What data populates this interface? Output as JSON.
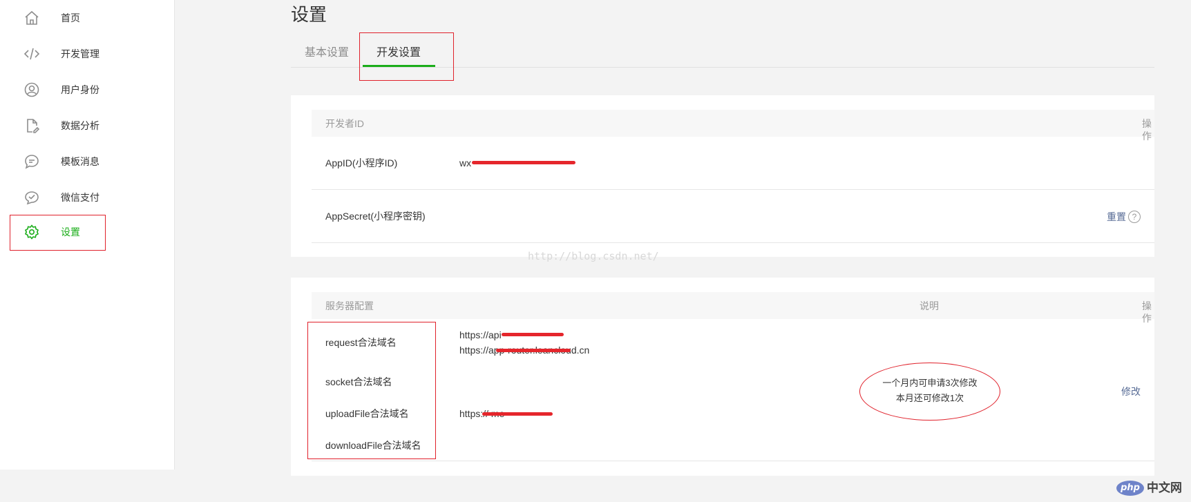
{
  "sidebar": {
    "items": [
      {
        "label": "首页",
        "icon": "home-icon"
      },
      {
        "label": "开发管理",
        "icon": "code-icon"
      },
      {
        "label": "用户身份",
        "icon": "user-icon"
      },
      {
        "label": "数据分析",
        "icon": "file-edit-icon"
      },
      {
        "label": "模板消息",
        "icon": "chat-icon"
      },
      {
        "label": "微信支付",
        "icon": "wechat-pay-icon"
      },
      {
        "label": "设置",
        "icon": "gear-icon",
        "active": true
      }
    ]
  },
  "page": {
    "title": "设置"
  },
  "tabs": [
    {
      "label": "基本设置"
    },
    {
      "label": "开发设置",
      "active": true
    }
  ],
  "developer_id": {
    "header": {
      "name": "开发者ID",
      "action": "操作"
    },
    "rows": [
      {
        "label": "AppID(小程序ID)",
        "value": "wx"
      },
      {
        "label": "AppSecret(小程序密钥)",
        "action": "重置",
        "help": "?"
      }
    ]
  },
  "server_config": {
    "header": {
      "name": "服务器配置",
      "desc": "说明",
      "action": "操作"
    },
    "rows": [
      {
        "label": "request合法域名",
        "values": [
          "https://api",
          "https://app-router.leancloud.cn"
        ]
      },
      {
        "label": "socket合法域名"
      },
      {
        "label": "uploadFile合法域名",
        "values": [
          "https://          me"
        ]
      },
      {
        "label": "downloadFile合法域名"
      }
    ],
    "note": [
      "一个月内可申请3次修改",
      "本月还可修改1次"
    ],
    "action": "修改"
  },
  "watermark": "http://blog.csdn.net/",
  "logo": {
    "php": "php",
    "cn": "中文网"
  },
  "colors": {
    "accent": "#1aad19",
    "link": "#576b95",
    "annotation": "#e0202a"
  }
}
